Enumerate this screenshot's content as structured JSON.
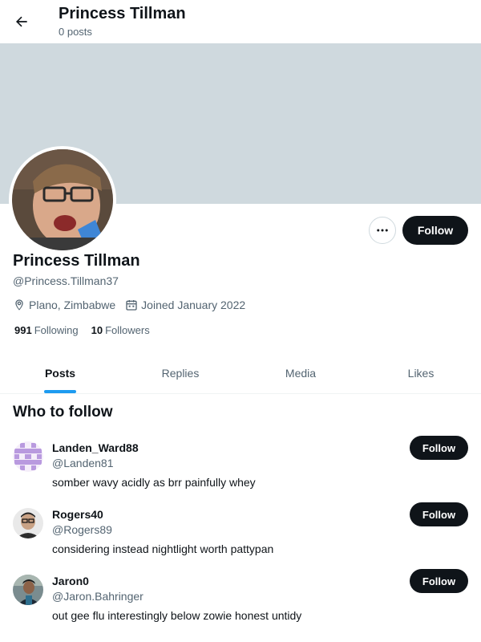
{
  "header": {
    "title": "Princess Tillman",
    "post_count": "0 posts"
  },
  "profile": {
    "name": "Princess Tillman",
    "handle": "@Princess.Tillman37",
    "location": "Plano, Zimbabwe",
    "joined": "Joined January 2022",
    "following_count": "991",
    "following_label": "Following",
    "followers_count": "10",
    "followers_label": "Followers",
    "follow_label": "Follow",
    "more_icon": "more-horizontal-icon"
  },
  "tabs": [
    {
      "label": "Posts",
      "active": true
    },
    {
      "label": "Replies",
      "active": false
    },
    {
      "label": "Media",
      "active": false
    },
    {
      "label": "Likes",
      "active": false
    }
  ],
  "who_to_follow": {
    "title": "Who to follow",
    "users": [
      {
        "name": "Landen_Ward88",
        "handle": "@Landen81",
        "bio": "somber wavy acidly as brr painfully whey",
        "follow_label": "Follow"
      },
      {
        "name": "Rogers40",
        "handle": "@Rogers89",
        "bio": "considering instead nightlight worth pattypan",
        "follow_label": "Follow"
      },
      {
        "name": "Jaron0",
        "handle": "@Jaron.Bahringer",
        "bio": "out gee flu interestingly below zowie honest untidy",
        "follow_label": "Follow"
      }
    ]
  },
  "colors": {
    "banner": "#cfd9de",
    "accent": "#1d9bf0",
    "button": "#0f1419"
  }
}
